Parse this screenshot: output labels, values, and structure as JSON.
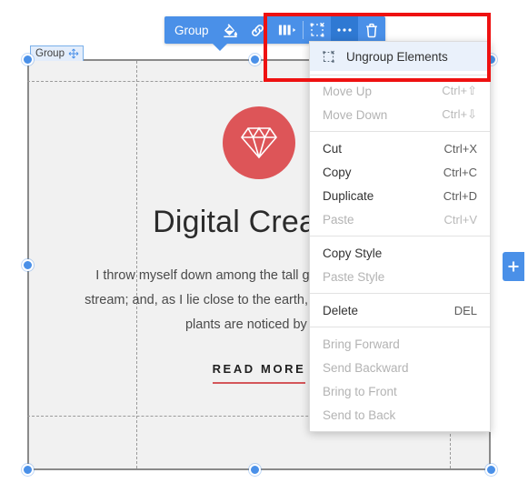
{
  "toolbar": {
    "group_label": "Group",
    "buttons": [
      {
        "name": "background-fill-icon",
        "title": "Background"
      },
      {
        "name": "link-icon",
        "title": "Link"
      },
      {
        "name": "columns-icon",
        "title": "Columns"
      },
      {
        "name": "ungroup-icon",
        "title": "Ungroup"
      },
      {
        "name": "more-options-icon",
        "title": "More"
      },
      {
        "name": "delete-icon",
        "title": "Delete"
      }
    ]
  },
  "selection": {
    "badge_label": "Group",
    "badge_icon": "move-icon"
  },
  "menu": {
    "groups": [
      {
        "items": [
          {
            "label": "Ungroup Elements",
            "shortcut": "",
            "disabled": false,
            "highlighted": true,
            "icon": "ungroup-icon"
          }
        ]
      },
      {
        "items": [
          {
            "label": "Move Up",
            "shortcut": "Ctrl+⇧",
            "disabled": true,
            "highlighted": false
          },
          {
            "label": "Move Down",
            "shortcut": "Ctrl+⇩",
            "disabled": true,
            "highlighted": false
          }
        ]
      },
      {
        "items": [
          {
            "label": "Cut",
            "shortcut": "Ctrl+X",
            "disabled": false,
            "highlighted": false
          },
          {
            "label": "Copy",
            "shortcut": "Ctrl+C",
            "disabled": false,
            "highlighted": false
          },
          {
            "label": "Duplicate",
            "shortcut": "Ctrl+D",
            "disabled": false,
            "highlighted": false
          },
          {
            "label": "Paste",
            "shortcut": "Ctrl+V",
            "disabled": true,
            "highlighted": false
          }
        ]
      },
      {
        "items": [
          {
            "label": "Copy Style",
            "shortcut": "",
            "disabled": false,
            "highlighted": false
          },
          {
            "label": "Paste Style",
            "shortcut": "",
            "disabled": true,
            "highlighted": false
          }
        ]
      },
      {
        "items": [
          {
            "label": "Delete",
            "shortcut": "DEL",
            "disabled": false,
            "highlighted": false
          }
        ]
      },
      {
        "items": [
          {
            "label": "Bring Forward",
            "shortcut": "",
            "disabled": true,
            "highlighted": false
          },
          {
            "label": "Send Backward",
            "shortcut": "",
            "disabled": true,
            "highlighted": false
          },
          {
            "label": "Bring to Front",
            "shortcut": "",
            "disabled": true,
            "highlighted": false
          },
          {
            "label": "Send to Back",
            "shortcut": "",
            "disabled": true,
            "highlighted": false
          }
        ]
      }
    ]
  },
  "canvas": {
    "logo_icon": "diamond-icon",
    "headline": "Digital Creative",
    "paragraph": "I throw myself down among the tall grass by the trickling stream; and, as I lie close to the earth, a thousand unknown plants are noticed by me.",
    "cta_label": "READ MORE"
  },
  "add_tab": {
    "icon": "plus-icon"
  },
  "colors": {
    "accent_blue": "#4a90e8",
    "accent_blue_dark": "#2f79d3",
    "logo_red": "#dd5558",
    "cta_underline": "#d4565a",
    "annotation_red": "#ee1111",
    "canvas_bg": "#f1f1f1"
  }
}
